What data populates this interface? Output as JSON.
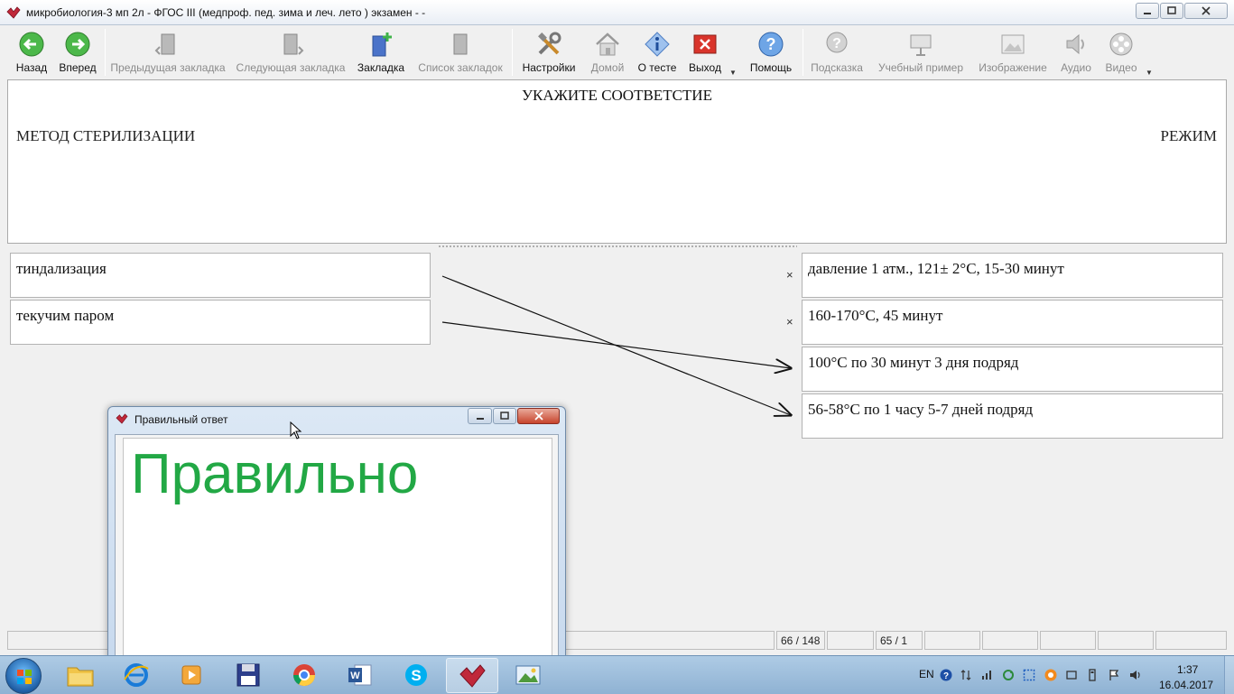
{
  "window": {
    "title": "микробиология-3 мп 2л - ФГОС III (медпроф. пед. зима и леч. лето ) экзамен -  -"
  },
  "toolbar": {
    "back": "Назад",
    "forward": "Вперед",
    "prev_bookmark": "Предыдущая закладка",
    "next_bookmark": "Следующая закладка",
    "bookmark": "Закладка",
    "bookmark_list": "Список закладок",
    "settings": "Настройки",
    "home": "Домой",
    "about": "О тесте",
    "exit": "Выход",
    "help": "Помощь",
    "hint": "Подсказка",
    "example": "Учебный пример",
    "image": "Изображение",
    "audio": "Аудио",
    "video": "Видео"
  },
  "question": {
    "title": "УКАЖИТЕ СООТВЕТСТИЕ",
    "left_header": "МЕТОД СТЕРИЛИЗАЦИИ",
    "right_header": "РЕЖИМ"
  },
  "match": {
    "left": [
      {
        "text": "тиндализация"
      },
      {
        "text": "текучим паром"
      }
    ],
    "right": [
      {
        "text": "давление 1 атм., 121± 2°С, 15-30 минут"
      },
      {
        "text": "160-170°С, 45 минут"
      },
      {
        "text": "100°С по 30 минут 3 дня подряд"
      },
      {
        "text": "56-58°С по 1 часу 5-7 дней подряд"
      }
    ],
    "clear_symbol": "×",
    "links": [
      {
        "from": 0,
        "to": 3
      },
      {
        "from": 1,
        "to": 2
      }
    ]
  },
  "status": {
    "progress": "66 / 148",
    "score": "65 / 1"
  },
  "modal": {
    "title": "Правильный ответ",
    "message": "Правильно",
    "message_color": "#22a845"
  },
  "taskbar": {
    "lang": "EN",
    "time": "1:37",
    "date": "16.04.2017"
  }
}
